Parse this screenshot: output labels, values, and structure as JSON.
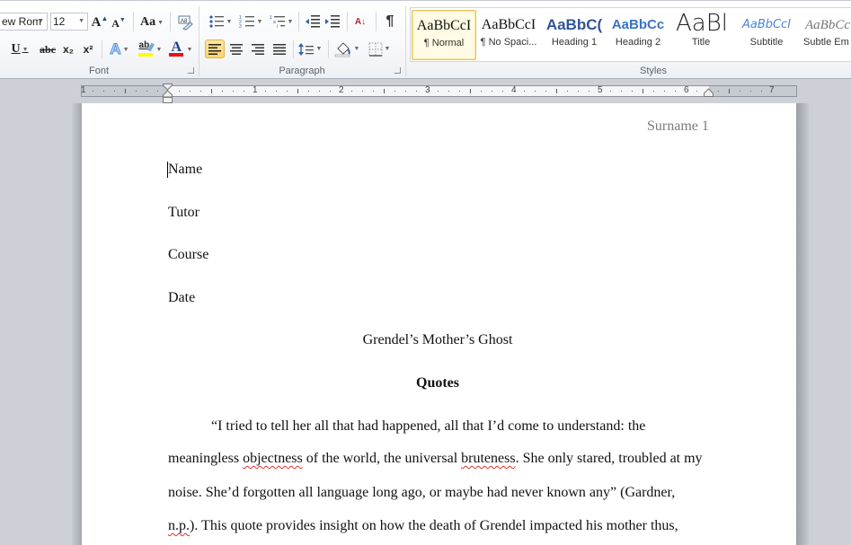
{
  "ribbon": {
    "font_group": {
      "label": "Font",
      "font_name": "ew Rom",
      "font_size": "12",
      "grow_font_label": "A",
      "shrink_font_label": "A",
      "change_case_label": "Aa",
      "underline_label": "U",
      "strikethrough_label": "abc",
      "subscript_label": "x₂",
      "superscript_label": "x²",
      "text_effects_label": "A",
      "highlight_label": "ab",
      "font_color_label": "A",
      "highlight_color": "#ffff00",
      "font_color": "#e8101b"
    },
    "paragraph_group": {
      "label": "Paragraph",
      "sort_label": "A↓",
      "show_marks_label": "¶",
      "active_alignment": "align-left"
    },
    "styles_group": {
      "label": "Styles",
      "items": [
        {
          "preview": "AaBbCcI",
          "name": "¶ Normal",
          "active": true
        },
        {
          "preview": "AaBbCcI",
          "name": "¶ No Spaci...",
          "active": false
        },
        {
          "preview": "AaBbC(",
          "name": "Heading 1",
          "active": false
        },
        {
          "preview": "AaBbCc",
          "name": "Heading 2",
          "active": false
        },
        {
          "preview": "AaBl",
          "name": "Title",
          "active": false
        },
        {
          "preview": "AaBbCcI",
          "name": "Subtitle",
          "active": false
        },
        {
          "preview": "AaBbCc",
          "name": "Subtle Em",
          "active": false
        }
      ]
    }
  },
  "ruler": {
    "numbers": [
      "1",
      "1",
      "2",
      "3",
      "4",
      "5",
      "6",
      "7"
    ]
  },
  "document": {
    "header": "Surname 1",
    "lines": {
      "name": "Name",
      "tutor": "Tutor",
      "course": "Course",
      "date": "Date",
      "title": "Grendel’s Mother’s Ghost",
      "heading": "Quotes"
    },
    "body": {
      "l1": "“I tried to tell her all that had happened, all that I’d come to understand: the",
      "l2_a": "meaningless ",
      "l2_b": "objectness",
      "l2_c": " of the world, the universal ",
      "l2_d": "bruteness",
      "l2_e": ". She only stared, troubled at my",
      "l3": "noise. She’d forgotten all language long ago, or maybe had never known any” (Gardner,",
      "l4_a": "n.p.",
      "l4_b": "). This quote provides insight on how the death of Grendel impacted his mother thus,"
    }
  }
}
